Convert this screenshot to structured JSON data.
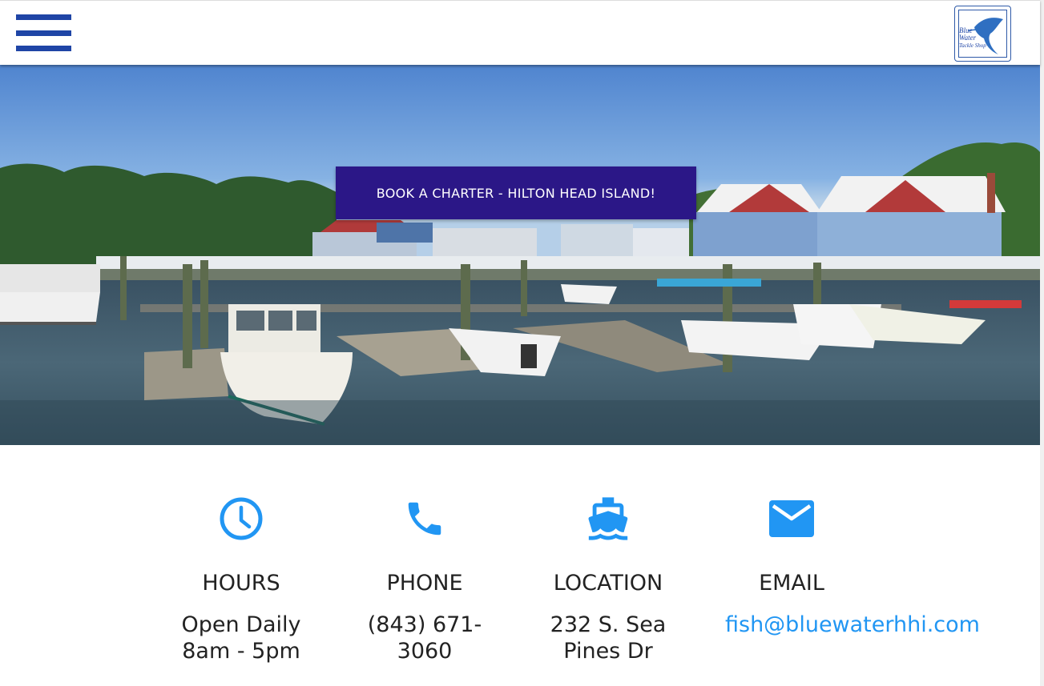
{
  "header": {
    "menu_icon": "hamburger-icon",
    "logo_lines": [
      "Blue",
      "Water",
      "Tackle Shop"
    ]
  },
  "hero": {
    "cta_label": "BOOK A CHARTER - HILTON HEAD ISLAND!"
  },
  "info": [
    {
      "icon": "clock-icon",
      "title": "HOURS",
      "value": "Open Daily 8am - 5pm"
    },
    {
      "icon": "phone-icon",
      "title": "PHONE",
      "value": "(843) 671-3060"
    },
    {
      "icon": "ferry-icon",
      "title": "LOCATION",
      "value": "232 S. Sea Pines Dr"
    },
    {
      "icon": "email-icon",
      "title": "EMAIL",
      "value": "fish@bluewaterhhi.com"
    }
  ],
  "colors": {
    "accent": "#2196f3",
    "cta": "#2b1787",
    "menu": "#1f45a6"
  }
}
